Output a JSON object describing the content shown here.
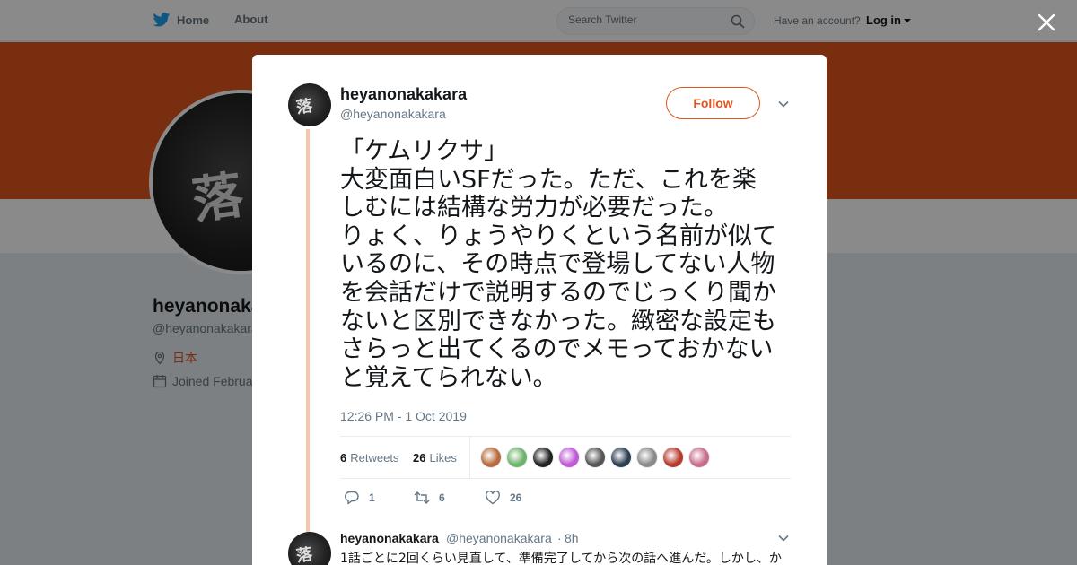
{
  "header": {
    "home_label": "Home",
    "about_label": "About",
    "search_placeholder": "Search Twitter",
    "account_prompt": "Have an account?",
    "login_label": "Log in"
  },
  "profile": {
    "name": "heyanonakakara",
    "handle": "@heyanonakakara",
    "location": "日本",
    "joined": "Joined Februa",
    "banner_color": "#e0551e"
  },
  "tweet": {
    "fullname": "heyanonakakara",
    "username": "@heyanonakakara",
    "follow_label": "Follow",
    "text": "「ケムリクサ」\n大変面白いSFだった。ただ、これを楽しむには結構な労力が必要だった。\nりょく、りょうやりくという名前が似ているのに、その時点で登場してない人物を会話だけで説明するのでじっくり聞かないと区別できなかった。緻密な設定もさらっと出てくるのでメモっておかないと覚えてられない。",
    "timestamp": "12:26 PM - 1 Oct 2019",
    "retweets_count": "6",
    "retweets_label": "Retweets",
    "likes_count": "26",
    "likes_label": "Likes",
    "liker_colors": [
      "#b86a3c",
      "#6fb36a",
      "#222222",
      "#c05ad6",
      "#555555",
      "#2c3e50",
      "#8a8a8a",
      "#b8392e",
      "#c96c8a"
    ],
    "action_reply_count": "1",
    "action_retweet_count": "6",
    "action_like_count": "26"
  },
  "reply": {
    "fullname": "heyanonakakara",
    "username": "@heyanonakakara",
    "separator": "·",
    "time": "8h",
    "text": "1話ごとに2回くらい見直して、準備完了してから次の話へ進んだ。しかし、か"
  },
  "icons": [
    "twitter-bird-icon",
    "search-icon",
    "close-icon",
    "location-icon",
    "calendar-icon",
    "chevron-down-icon",
    "reply-icon",
    "retweet-icon",
    "heart-icon"
  ]
}
